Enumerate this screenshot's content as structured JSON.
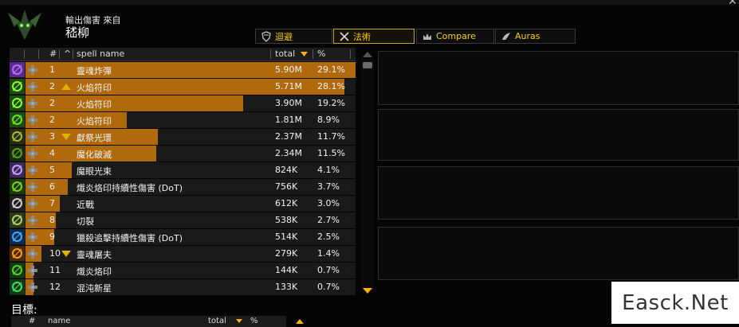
{
  "window": {
    "title": ""
  },
  "header": {
    "subtitle": "輸出傷害 來自",
    "name": "嵇柳"
  },
  "tabs": [
    {
      "label": "迴避",
      "icon": "shield-icon",
      "active": false
    },
    {
      "label": "法術",
      "icon": "crossed-swords-icon",
      "active": true
    },
    {
      "label": "Compare",
      "icon": "crown-icon",
      "active": false
    },
    {
      "label": "Auras",
      "icon": "wing-icon",
      "active": false
    }
  ],
  "columns": {
    "rank": "#",
    "caret": "^",
    "spell": "spell name",
    "total": "total",
    "pct": "%"
  },
  "colors": {
    "bar": "#b06a0c",
    "accent": "#ffd100",
    "divider": "#2e2e2e"
  },
  "rows": [
    {
      "rank": "1",
      "change": "",
      "spell": "靈魂炸彈",
      "total": "5.90M",
      "pct": "29.1%",
      "pct_value": 29.1,
      "icon": "purple-soul-icon"
    },
    {
      "rank": "2",
      "change": "up",
      "spell": "火焰符印",
      "total": "5.71M",
      "pct": "28.1%",
      "pct_value": 28.1,
      "icon": "green-sigil-icon"
    },
    {
      "rank": "2",
      "change": "",
      "spell": "火焰符印",
      "total": "3.90M",
      "pct": "19.2%",
      "pct_value": 19.2,
      "icon": "green-sigil-icon"
    },
    {
      "rank": "2",
      "change": "",
      "spell": "火焰符印",
      "total": "1.81M",
      "pct": "8.9%",
      "pct_value": 8.9,
      "icon": "green-fel-icon"
    },
    {
      "rank": "3",
      "change": "down",
      "spell": "獻祭光環",
      "total": "2.37M",
      "pct": "11.7%",
      "pct_value": 11.7,
      "icon": "demon-hunter-icon"
    },
    {
      "rank": "4",
      "change": "",
      "spell": "魔化破滅",
      "total": "2.34M",
      "pct": "11.5%",
      "pct_value": 11.5,
      "icon": "fel-wing-icon"
    },
    {
      "rank": "5",
      "change": "",
      "spell": "魔眼光束",
      "total": "824K",
      "pct": "4.1%",
      "pct_value": 4.1,
      "icon": "eye-beam-icon"
    },
    {
      "rank": "6",
      "change": "",
      "spell": "熾炎烙印持續性傷害 (DoT)",
      "total": "756K",
      "pct": "3.7%",
      "pct_value": 3.7,
      "icon": "fel-flame-icon"
    },
    {
      "rank": "7",
      "change": "",
      "spell": "近戰",
      "total": "612K",
      "pct": "3.0%",
      "pct_value": 3.0,
      "icon": "sword-icon"
    },
    {
      "rank": "8",
      "change": "",
      "spell": "切裂",
      "total": "538K",
      "pct": "2.7%",
      "pct_value": 2.7,
      "icon": "shear-icon"
    },
    {
      "rank": "9",
      "change": "",
      "spell": "獵殺追擊持續性傷害 (DoT)",
      "total": "514K",
      "pct": "2.5%",
      "pct_value": 2.5,
      "icon": "blue-swirl-icon"
    },
    {
      "rank": "10",
      "change": "down",
      "spell": "靈魂屠夫",
      "total": "279K",
      "pct": "1.4%",
      "pct_value": 1.4,
      "icon": "orange-claw-icon"
    },
    {
      "rank": "11",
      "change": "",
      "spell": "熾炎烙印",
      "total": "144K",
      "pct": "0.7%",
      "pct_value": 0.7,
      "icon": "green-burn-icon"
    },
    {
      "rank": "12",
      "change": "",
      "spell": "混沌新星",
      "total": "133K",
      "pct": "0.7%",
      "pct_value": 0.7,
      "icon": "chaos-nova-icon"
    }
  ],
  "targets": {
    "label": "目標:",
    "columns": {
      "rank": "#",
      "name": "name",
      "total": "total",
      "pct": "%"
    }
  },
  "watermark": "Easck.Net"
}
